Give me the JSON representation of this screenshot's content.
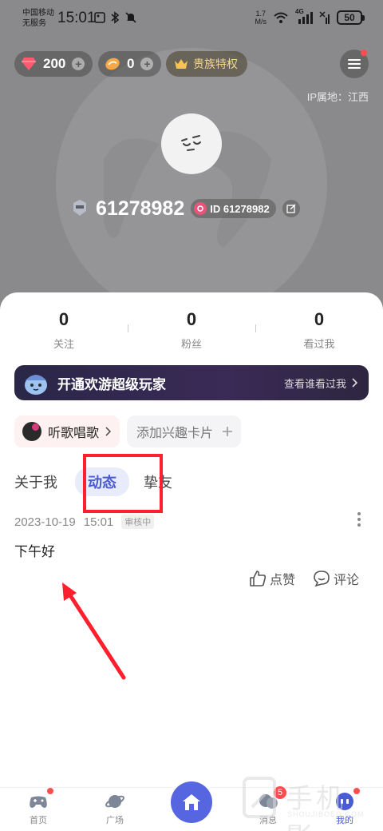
{
  "status_bar": {
    "carrier_line1": "中国移动",
    "carrier_line2": "无服务",
    "time": "15:01",
    "net_speed_value": "1.7",
    "net_speed_unit": "M/s",
    "signal_label": "4G",
    "battery": "50"
  },
  "header": {
    "diamonds": "200",
    "beans": "0",
    "vip_label": "贵族特权",
    "ip_location": "IP属地：江西",
    "username": "61278982",
    "id_label": "ID 61278982"
  },
  "stats": [
    {
      "value": "0",
      "label": "关注"
    },
    {
      "value": "0",
      "label": "粉丝"
    },
    {
      "value": "0",
      "label": "看过我"
    }
  ],
  "vip_banner": {
    "title": "开通欢游超级玩家",
    "action": "查看谁看过我"
  },
  "interests": {
    "sing": "听歌唱歌",
    "add": "添加兴趣卡片"
  },
  "tabs": {
    "about": "关于我",
    "moments": "动态",
    "friends": "挚友"
  },
  "post": {
    "date": "2023-10-19",
    "time": "15:01",
    "status": "审核中",
    "text": "下午好",
    "like": "点赞",
    "comment": "评论"
  },
  "bottom_nav": {
    "home": "首页",
    "square": "广场",
    "messages": "消息",
    "messages_badge": "5",
    "mine": "我的"
  },
  "watermark": {
    "text": "手机影",
    "sub": "SHOUJIBOEO.COM"
  },
  "colors": {
    "accent": "#4a5bd4",
    "highlight_red": "#ff1f2d",
    "badge_red": "#ff4d4f"
  }
}
